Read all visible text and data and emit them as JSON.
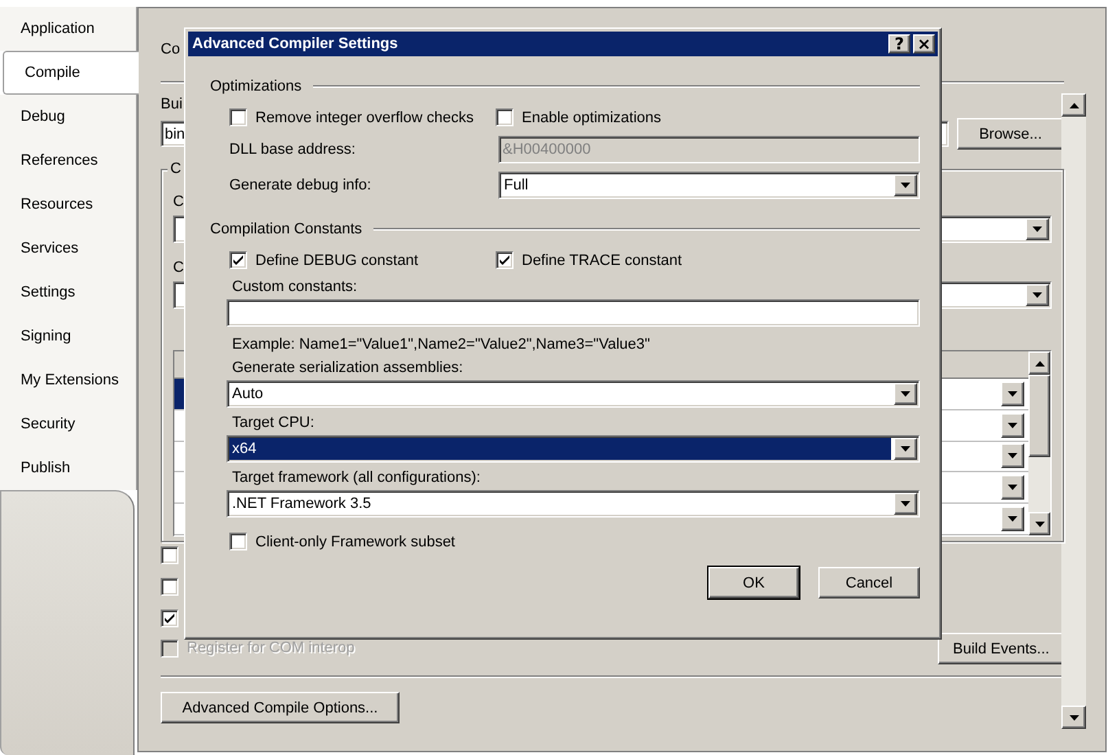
{
  "tabs": [
    {
      "label": "Application",
      "selected": false
    },
    {
      "label": "Compile",
      "selected": true
    },
    {
      "label": "Debug",
      "selected": false
    },
    {
      "label": "References",
      "selected": false
    },
    {
      "label": "Resources",
      "selected": false
    },
    {
      "label": "Services",
      "selected": false
    },
    {
      "label": "Settings",
      "selected": false
    },
    {
      "label": "Signing",
      "selected": false
    },
    {
      "label": "My Extensions",
      "selected": false
    },
    {
      "label": "Security",
      "selected": false
    },
    {
      "label": "Publish",
      "selected": false
    }
  ],
  "page": {
    "header": "Co",
    "build_output_label": "Bui",
    "build_output_path": "bin",
    "browse_button": "Browse...",
    "group_title": "C",
    "label_1": "C",
    "label_2": "C",
    "grid_rows": [
      {
        "selected": true
      },
      {
        "selected": false
      },
      {
        "selected": false
      },
      {
        "selected": false
      },
      {
        "selected": false
      }
    ],
    "checkboxes": [
      {
        "checked": false
      },
      {
        "checked": false
      },
      {
        "checked": true
      }
    ],
    "com_interop": {
      "label": "Register for COM interop",
      "checked": false,
      "disabled": true
    },
    "build_events_button": "Build Events...",
    "advanced_button": "Advanced Compile Options..."
  },
  "dialog": {
    "title": "Advanced Compiler Settings",
    "help_button": "?",
    "close_button": "×",
    "optimizations": {
      "title": "Optimizations",
      "checkboxes": [
        {
          "label": "Remove integer overflow checks",
          "checked": false
        },
        {
          "label": "Enable optimizations",
          "checked": false
        }
      ],
      "dll_base_address": {
        "label": "DLL base address:",
        "value": "&H00400000",
        "disabled": true
      },
      "debug_info": {
        "label": "Generate debug info:",
        "value": "Full"
      }
    },
    "constants": {
      "title": "Compilation Constants",
      "checkboxes": [
        {
          "label": "Define DEBUG constant",
          "checked": true
        },
        {
          "label": "Define TRACE constant",
          "checked": true
        }
      ],
      "custom_label": "Custom constants:",
      "example": "Example: Name1=\"Value1\",Name2=\"Value2\",Name3=\"Value3\"",
      "serialization": {
        "label": "Generate serialization assemblies:",
        "value": "Auto",
        "selected": false
      },
      "target_cpu": {
        "label": "Target CPU:",
        "value": "x64",
        "selected": true
      },
      "target_framework": {
        "label": "Target framework (all configurations):",
        "value": ".NET Framework 3.5",
        "selected": false
      },
      "client_only": {
        "label": "Client-only Framework subset",
        "checked": false
      }
    },
    "buttons": [
      {
        "label": "OK",
        "default": true
      },
      {
        "label": "Cancel",
        "default": false
      }
    ]
  }
}
